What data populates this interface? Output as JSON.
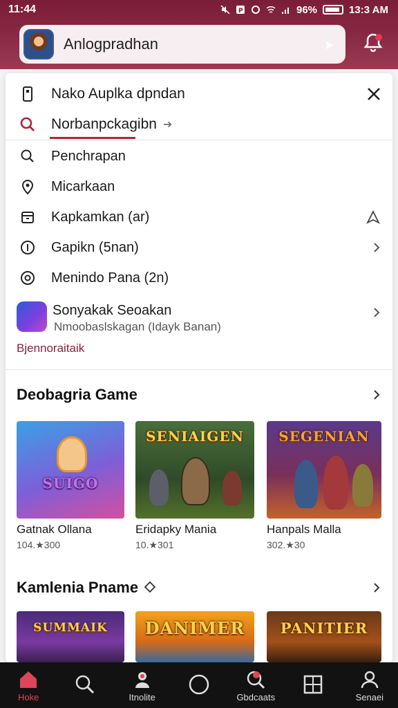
{
  "status_bar": {
    "time": "11:44",
    "battery_pct": "96%",
    "clock_right": "13:3 AM"
  },
  "header": {
    "search_title": "Anlogpradhan"
  },
  "dropdown": {
    "title": "Nako Auplka dpndan",
    "query": "Norbanpckagibn",
    "suggestions": [
      {
        "label": "Penchrapan",
        "icon": "search-icon"
      },
      {
        "label": "Micarkaan",
        "icon": "location-pin-icon"
      },
      {
        "label": "Kapkamkan (ar)",
        "icon": "archive-icon"
      },
      {
        "label": "Gapikn (5nan)",
        "icon": "info-circle-icon"
      },
      {
        "label": "Menindo Pana (2n)",
        "icon": "target-icon"
      }
    ],
    "app_suggestion": {
      "title": "Sonyakak Seoakan",
      "subtitle": "Nmoobaslskagan (Idayk Banan)"
    },
    "more_link": "Bjennoraitaik"
  },
  "sections": [
    {
      "title": "Deobagria Game",
      "cards": [
        {
          "name": "Gatnak Ollana",
          "meta": "104.★300",
          "thumb_text": "SUIGO"
        },
        {
          "name": "Eridapky Mania",
          "meta": "10.★301",
          "thumb_text": "SENIAIGEN"
        },
        {
          "name": "Hanpals Malla",
          "meta": "302.★30",
          "thumb_text": "SEGENIAN"
        }
      ]
    },
    {
      "title": "Kamlenia Pname",
      "cards": [
        {
          "name": "",
          "meta": "",
          "thumb_text": "SUMMAIK"
        },
        {
          "name": "",
          "meta": "",
          "thumb_text": "DANIMER"
        },
        {
          "name": "",
          "meta": "",
          "thumb_text": "PANITIER"
        }
      ]
    }
  ],
  "bottom_nav": [
    {
      "label": "Hoke",
      "icon": "home-icon"
    },
    {
      "label": "",
      "icon": "search-icon"
    },
    {
      "label": "Itnolite",
      "icon": "apps-icon"
    },
    {
      "label": "",
      "icon": "circle-icon"
    },
    {
      "label": "Gbdcaats",
      "icon": "search-badge-icon"
    },
    {
      "label": "",
      "icon": "grid-icon"
    },
    {
      "label": "Senaei",
      "icon": "profile-icon"
    }
  ],
  "colors": {
    "brand": "#8a2a45",
    "accent": "#b0243f",
    "nav_bg": "#121212"
  }
}
